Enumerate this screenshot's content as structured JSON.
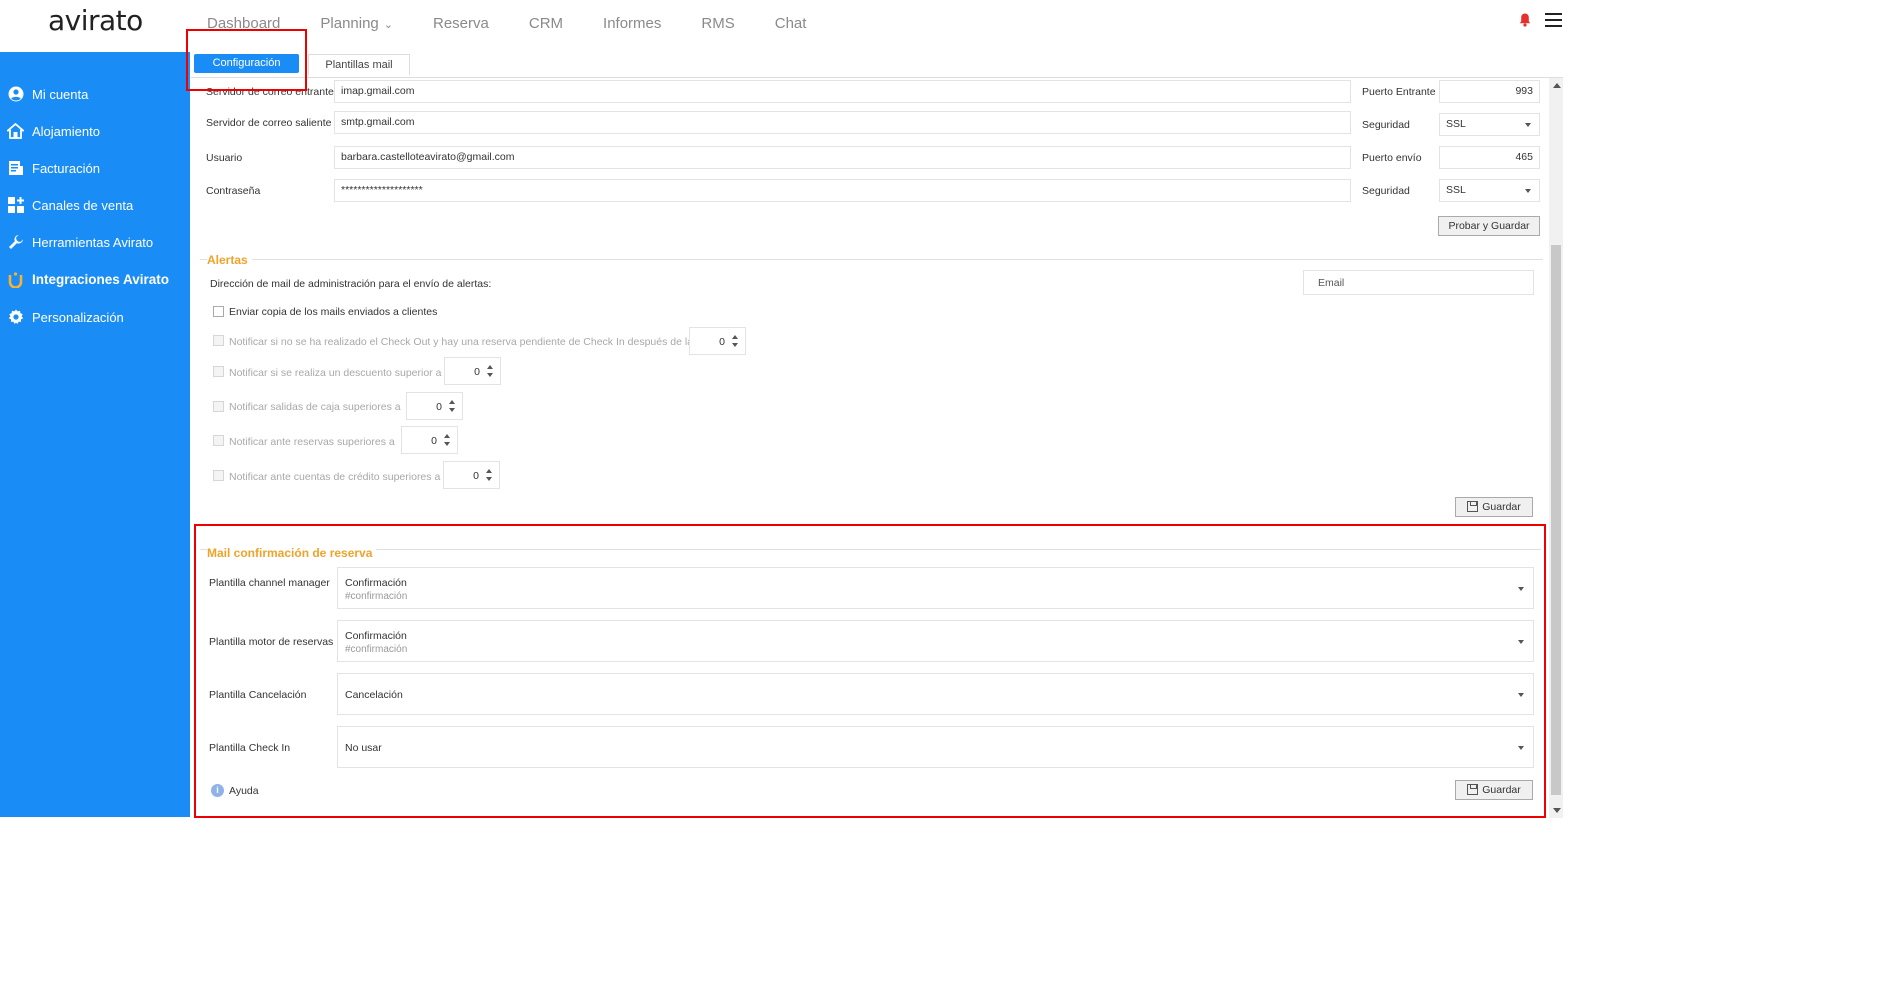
{
  "app": {
    "logo": "avirato"
  },
  "nav": {
    "items": [
      {
        "label": "Dashboard"
      },
      {
        "label": "Planning"
      },
      {
        "label": "Reserva"
      },
      {
        "label": "CRM"
      },
      {
        "label": "Informes"
      },
      {
        "label": "RMS"
      },
      {
        "label": "Chat"
      }
    ]
  },
  "sidebar": {
    "items": [
      {
        "label": "Mi cuenta",
        "icon": "user-circle-icon"
      },
      {
        "label": "Alojamiento",
        "icon": "house-icon"
      },
      {
        "label": "Facturación",
        "icon": "invoice-icon"
      },
      {
        "label": "Canales de venta",
        "icon": "grid-plus-icon"
      },
      {
        "label": "Herramientas Avirato",
        "icon": "wrench-icon"
      },
      {
        "label": "Integraciones Avirato",
        "icon": "integration-icon"
      },
      {
        "label": "Personalización",
        "icon": "gear-icon"
      }
    ]
  },
  "tabs": {
    "active": "Configuración",
    "other": "Plantillas mail"
  },
  "mail_server": {
    "incoming_label": "Servidor de correo entrante",
    "incoming_value": "imap.gmail.com",
    "outgoing_label": "Servidor de correo saliente",
    "outgoing_value": "smtp.gmail.com",
    "user_label": "Usuario",
    "user_value": "barbara.castelloteavirato@gmail.com",
    "password_label": "Contraseña",
    "password_value": "********************",
    "port_in_label": "Puerto Entrante",
    "port_in_value": "993",
    "security_label_1": "Seguridad",
    "security_value_1": "SSL",
    "port_out_label": "Puerto envío",
    "port_out_value": "465",
    "security_label_2": "Seguridad",
    "security_value_2": "SSL",
    "test_save_button": "Probar y Guardar"
  },
  "alerts": {
    "title": "Alertas",
    "admin_mail_label": "Dirección de mail de administración para el envío de alertas:",
    "email_placeholder": "Email",
    "send_copy_label": "Enviar copia de los mails enviados a clientes",
    "notify_checkout_label": "Notificar si no se ha realizado el Check Out y hay una reserva pendiente de Check In después de las",
    "notify_checkout_value": "0",
    "notify_discount_label": "Notificar si se realiza un descuento superior a",
    "notify_discount_value": "0",
    "notify_cash_label": "Notificar salidas de caja superiores a",
    "notify_cash_value": "0",
    "notify_bookings_label": "Notificar ante reservas superiores a",
    "notify_bookings_value": "0",
    "notify_credit_label": "Notificar ante cuentas de crédito superiores a",
    "notify_credit_value": "0",
    "save_button": "Guardar"
  },
  "booking_mail": {
    "title": "Mail confirmación de reserva",
    "channel_label": "Plantilla channel manager",
    "channel_value": "Confirmación",
    "channel_sub": "#confirmación",
    "engine_label": "Plantilla motor de reservas",
    "engine_value": "Confirmación",
    "engine_sub": "#confirmación",
    "cancel_label": "Plantilla Cancelación",
    "cancel_value": "Cancelación",
    "checkin_label": "Plantilla Check In",
    "checkin_value": "No usar",
    "help_label": "Ayuda",
    "save_button": "Guardar"
  },
  "colors": {
    "primary": "#1a8cf5",
    "accent": "#f0a32a",
    "highlight": "#e00000"
  }
}
